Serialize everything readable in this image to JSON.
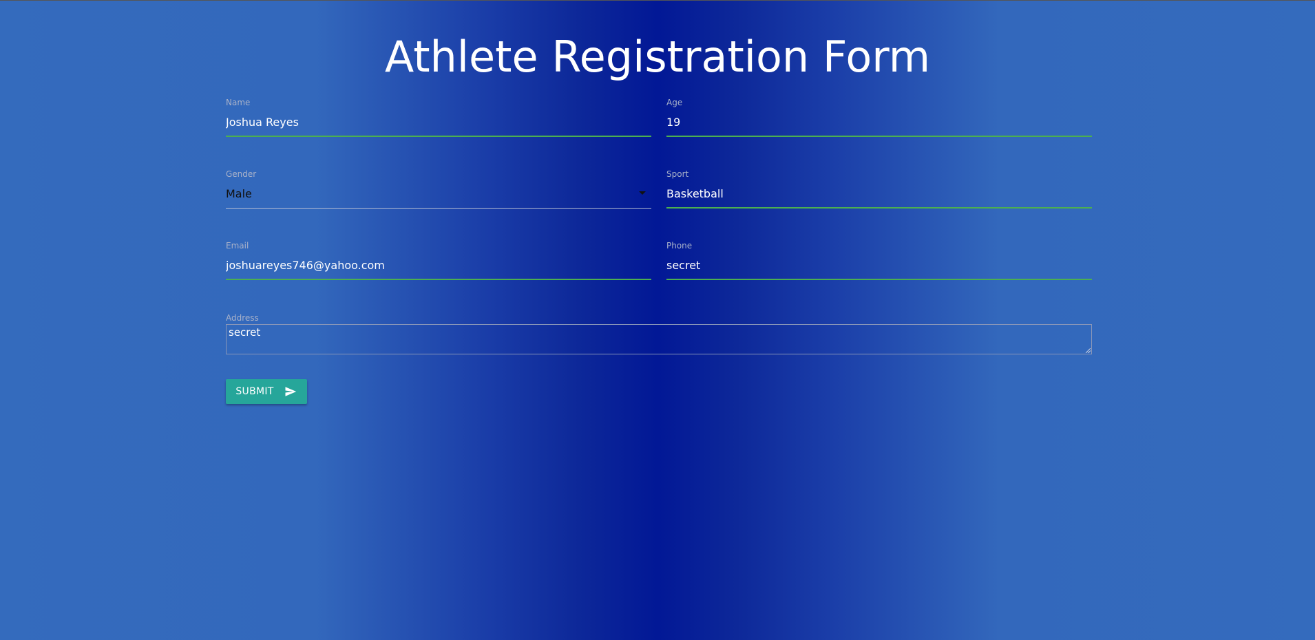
{
  "header": {
    "title": "Athlete Registration Form"
  },
  "form": {
    "name": {
      "label": "Name",
      "value": "Joshua Reyes"
    },
    "age": {
      "label": "Age",
      "value": "19"
    },
    "gender": {
      "label": "Gender",
      "value": "Male"
    },
    "sport": {
      "label": "Sport",
      "value": "Basketball"
    },
    "email": {
      "label": "Email",
      "value": "joshuareyes746@yahoo.com"
    },
    "phone": {
      "label": "Phone",
      "value": "secret"
    },
    "address": {
      "label": "Address",
      "value": "secret"
    },
    "submit_label": "SUBMIT"
  },
  "icons": {
    "submit": "send-icon",
    "gender_select": "caret-down-icon"
  },
  "colors": {
    "accent_underline": "#4caf50",
    "button": "#26a69a",
    "background_center": "#021896",
    "background_edge": "#346bbd"
  }
}
